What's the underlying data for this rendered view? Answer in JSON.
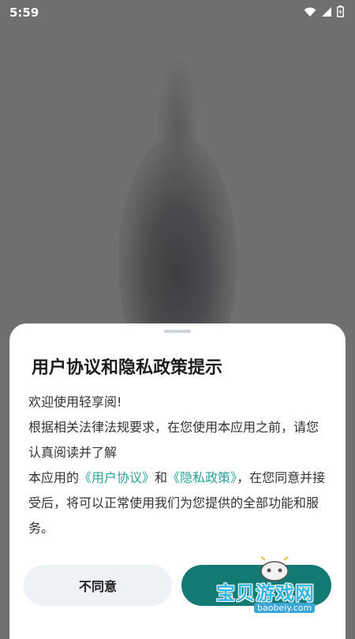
{
  "status_bar": {
    "time": "5:59",
    "icons": [
      "wifi-icon",
      "signal-icon",
      "battery-icon"
    ]
  },
  "dialog": {
    "title": "用户协议和隐私政策提示",
    "greeting": "欢迎使用轻享阅!",
    "line1": "根据相关法律法规要求，在您使用本应用之前，请您认真阅读并了解",
    "line2_prefix": "本应用的",
    "user_agreement_link": "《用户协议》",
    "line2_and": "和",
    "privacy_policy_link": "《隐私政策》",
    "line2_suffix": "，在您同意并接受后，将可以正常使用我们为您提供的全部功能和服务。",
    "disagree_label": "不同意",
    "agree_label": ""
  },
  "watermark": {
    "title": "宝贝游戏网",
    "url": "baobeiy.com"
  },
  "colors": {
    "link": "#2aa39a",
    "agree_button": "#127a73",
    "disagree_button": "#eef1f6",
    "backdrop": "#6f6f6f"
  }
}
